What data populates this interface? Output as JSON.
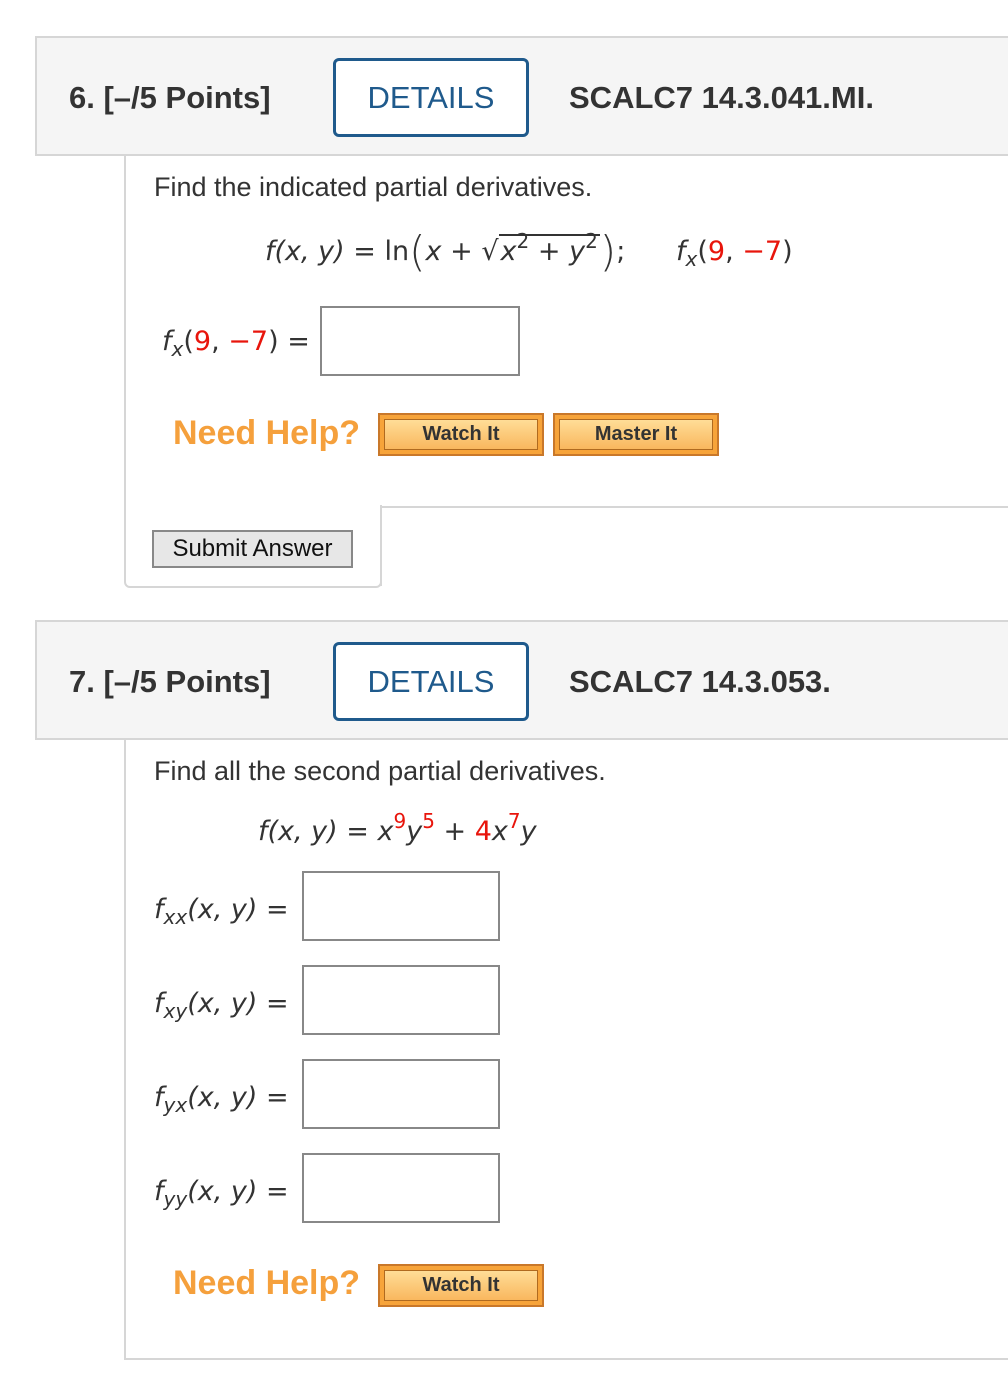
{
  "q6": {
    "number": "6.",
    "points": "[–/5 Points]",
    "details": "DETAILS",
    "code": "SCALC7 14.3.041.MI.",
    "prompt": "Find the indicated partial derivatives.",
    "func_lhs": "f(x, y)",
    "func_eq": "=",
    "func_ln": "ln",
    "func_x": "x",
    "func_plus": "+",
    "func_sqrt": "√",
    "func_x2": "x",
    "func_exp2": "2",
    "func_plus2": "+",
    "func_y2": "y",
    "func_exp2b": "2",
    "func_semi": ";",
    "eval_f": "f",
    "eval_sub": "x",
    "eval_open": "(",
    "eval_a": "9",
    "eval_comma": ", ",
    "eval_b": "−7",
    "eval_close": ")",
    "answer_label_eq": "=",
    "need_help": "Need Help?",
    "watch_it": "Watch It",
    "master_it": "Master It",
    "submit": "Submit Answer"
  },
  "q7": {
    "number": "7.",
    "points": "[–/5 Points]",
    "details": "DETAILS",
    "code": "SCALC7 14.3.053.",
    "prompt": "Find all the second partial derivatives.",
    "func_lhs": "f(x, y) = ",
    "x1": "x",
    "e1": "9",
    "y1": "y",
    "e2": "5",
    "plus": " + ",
    "c": "4",
    "x2": "x",
    "e3": "7",
    "y2": "y",
    "labels": [
      {
        "f": "f",
        "sub": "xx",
        "rest": "(x, y)",
        "eq": "="
      },
      {
        "f": "f",
        "sub": "xy",
        "rest": "(x, y)",
        "eq": "="
      },
      {
        "f": "f",
        "sub": "yx",
        "rest": "(x, y)",
        "eq": "="
      },
      {
        "f": "f",
        "sub": "yy",
        "rest": "(x, y)",
        "eq": "="
      }
    ],
    "need_help": "Need Help?",
    "watch_it": "Watch It"
  },
  "colors": {
    "accent_blue": "#1f5a8c",
    "help_orange": "#f5a03c",
    "value_red": "#e8150c"
  }
}
